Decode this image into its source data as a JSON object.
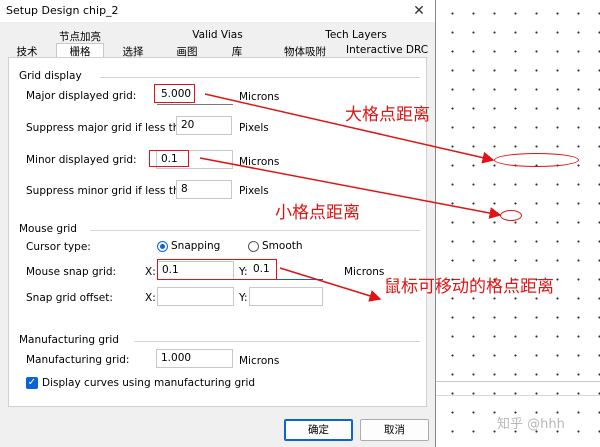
{
  "window": {
    "title": "Setup Design chip_2"
  },
  "tabs_row1": [
    {
      "label": "节点加亮"
    },
    {
      "label": "Valid Vias"
    },
    {
      "label": "Tech Layers"
    }
  ],
  "tabs_row2": [
    {
      "label": "技术"
    },
    {
      "label": "栅格"
    },
    {
      "label": "选择"
    },
    {
      "label": "画图"
    },
    {
      "label": "库"
    },
    {
      "label": "物体吸附"
    },
    {
      "label": "Interactive DRC"
    }
  ],
  "grid_display": {
    "title": "Grid display",
    "major_label": "Major displayed grid:",
    "major_value": "5.000",
    "major_unit": "Microns",
    "suppress_major_label": "Suppress major grid if less than:",
    "suppress_major_value": "20",
    "suppress_major_unit": "Pixels",
    "minor_label": "Minor displayed grid:",
    "minor_value": "0.1",
    "minor_unit": "Microns",
    "suppress_minor_label": "Suppress minor grid if less than:",
    "suppress_minor_value": "8",
    "suppress_minor_unit": "Pixels"
  },
  "mouse_grid": {
    "title": "Mouse grid",
    "cursor_label": "Cursor type:",
    "snapping_label": "Snapping",
    "smooth_label": "Smooth",
    "snap_label": "Mouse snap grid:",
    "x_label": "X:",
    "snap_x_value": "0.1",
    "y_label": "Y:",
    "snap_y_value": "0.1",
    "snap_unit": "Microns",
    "offset_label": "Snap grid offset:",
    "offset_x_label": "X:",
    "offset_x_value": "",
    "offset_y_label": "Y:",
    "offset_y_value": ""
  },
  "manufacturing_grid": {
    "title": "Manufacturing grid",
    "mfg_label": "Manufacturing grid:",
    "mfg_value": "1.000",
    "mfg_unit": "Microns",
    "curves_label": "Display curves using manufacturing grid"
  },
  "buttons": {
    "ok": "确定",
    "cancel": "取消"
  },
  "annotations": {
    "major": "大格点距离",
    "minor": "小格点距离",
    "snap": "鼠标可移动的格点距离",
    "color": "#e01414"
  },
  "watermark": "知乎 @hhh"
}
